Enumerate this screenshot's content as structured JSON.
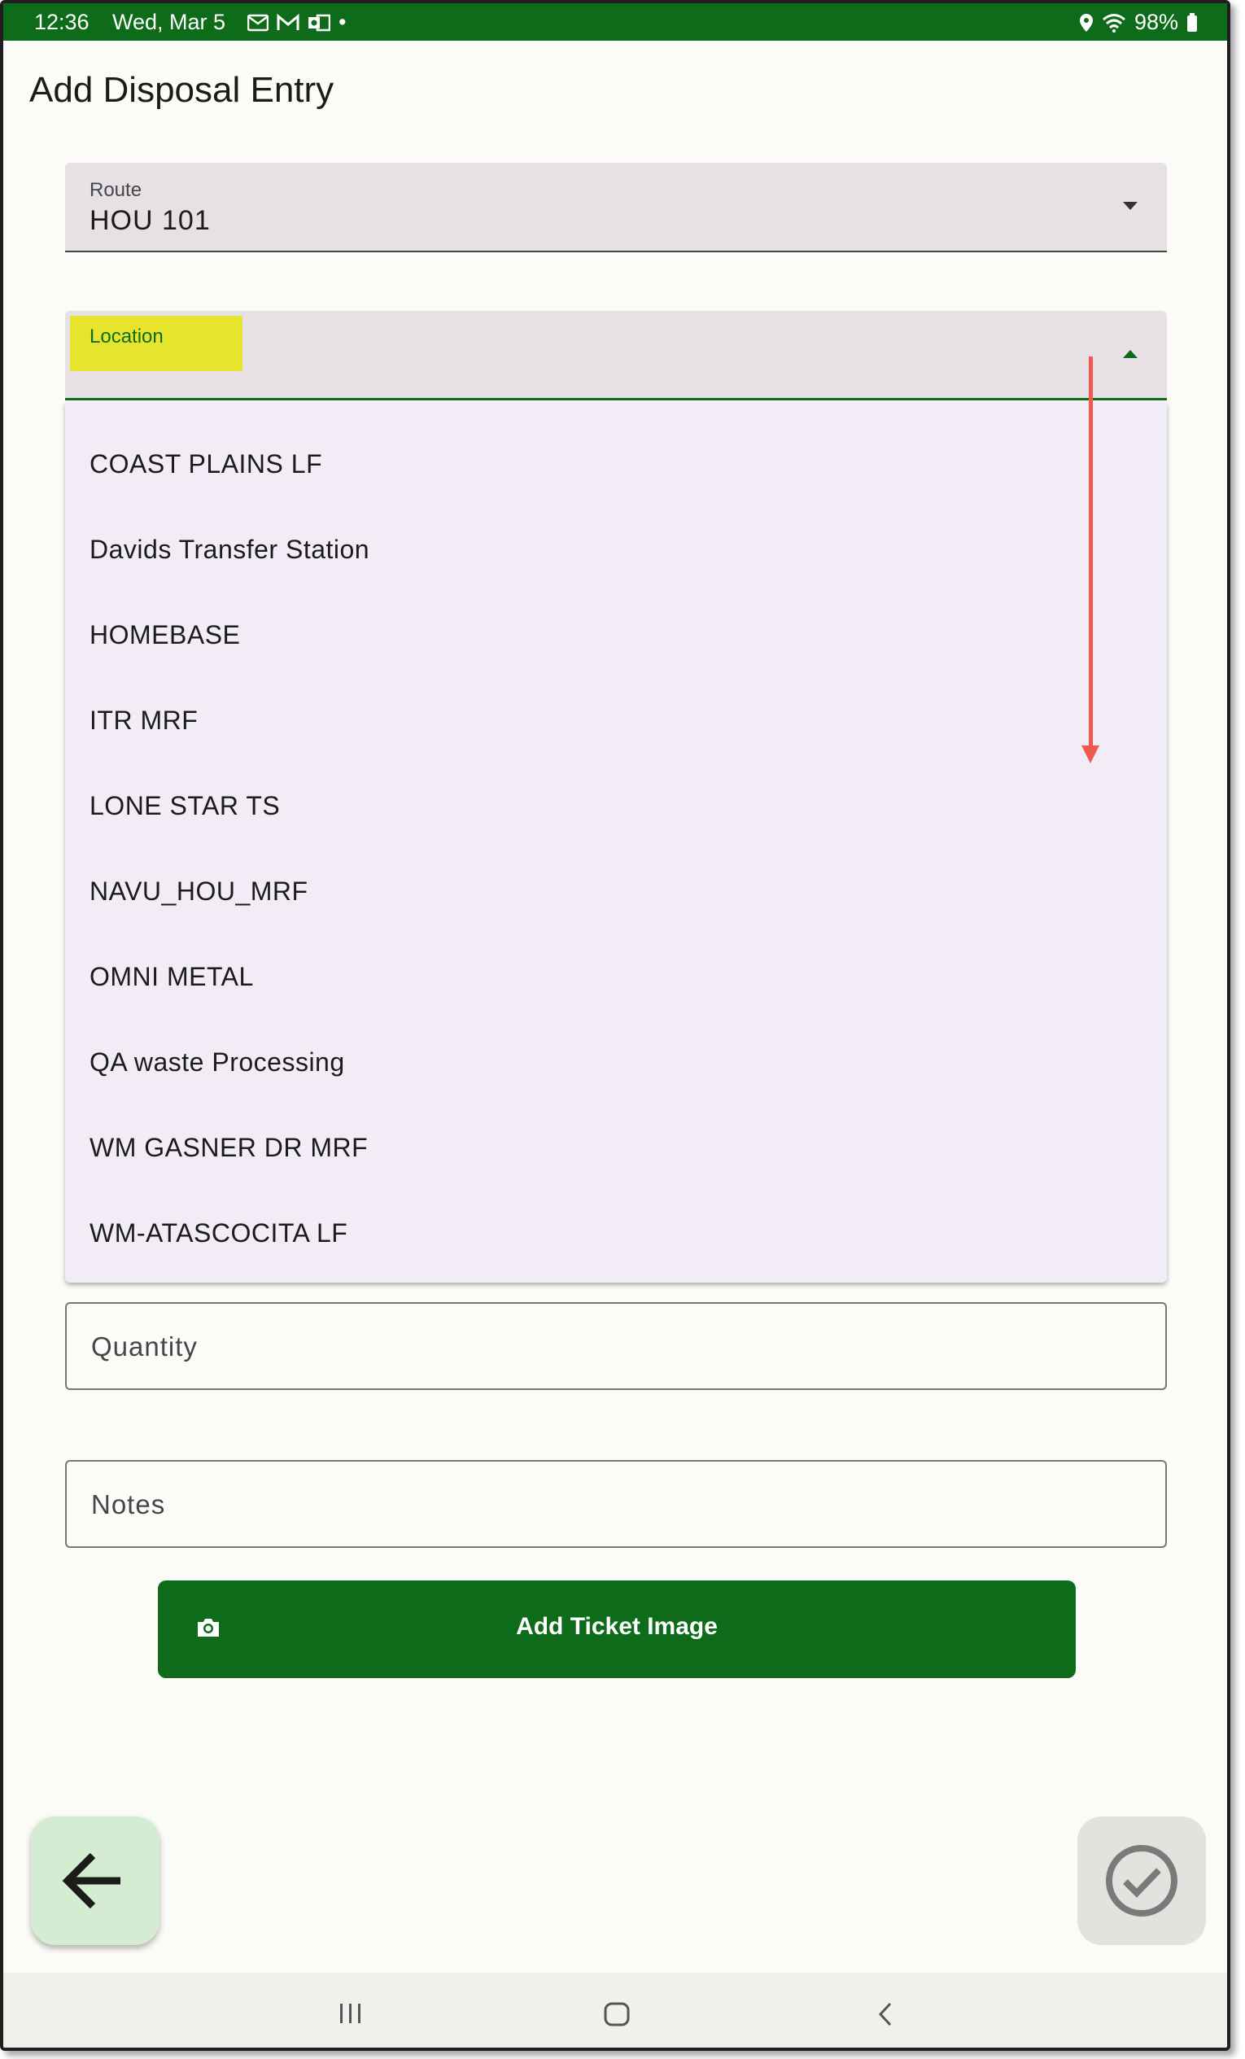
{
  "status_bar": {
    "time": "12:36",
    "date": "Wed, Mar 5",
    "dot": "•",
    "battery": "98%"
  },
  "page": {
    "title": "Add Disposal Entry"
  },
  "route_field": {
    "label": "Route",
    "value": "HOU 101"
  },
  "location_field": {
    "label": "Location",
    "value": ""
  },
  "location_options": [
    "COAST PLAINS LF",
    "Davids Transfer Station",
    "HOMEBASE",
    "ITR MRF",
    "LONE STAR TS",
    "NAVU_HOU_MRF",
    "OMNI METAL",
    "QA waste Processing",
    "WM GASNER DR MRF",
    "WM-ATASCOCITA LF"
  ],
  "quantity_field": {
    "placeholder": "Quantity"
  },
  "notes_field": {
    "placeholder": "Notes"
  },
  "ticket_button": {
    "label": "Add Ticket Image",
    "icon": "camera-icon"
  },
  "fabs": {
    "back_icon": "arrow-left-icon",
    "submit_icon": "check-circle-icon"
  },
  "nav_bar": {
    "recents_icon": "recents-icon",
    "home_icon": "home-icon",
    "back_icon": "back-icon"
  },
  "colors": {
    "primary": "#0d6b1a",
    "highlight": "#e6e42c",
    "annotation_arrow": "#f2584d",
    "menu_bg": "#f2ecf6",
    "fab_back_bg": "#d4ecd2"
  }
}
